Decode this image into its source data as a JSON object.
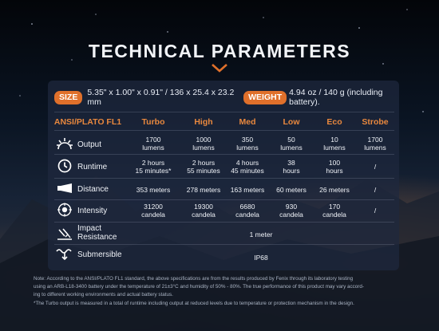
{
  "title": "TECHNICAL PARAMETERS",
  "specs": {
    "size_label": "SIZE",
    "size_value": "5.35\" x 1.00\" x 0.91\" / 136 x 25.4 x 23.2 mm",
    "weight_label": "WEIGHT",
    "weight_value": "4.94 oz / 140 g (including battery)."
  },
  "table": {
    "headers": [
      "ANSI/PLATO FL1",
      "Turbo",
      "High",
      "Med",
      "Low",
      "Eco",
      "Strobe"
    ],
    "rows": [
      {
        "icon": "output-icon",
        "label": "Output",
        "cells": [
          [
            "1700",
            "lumens"
          ],
          [
            "1000",
            "lumens"
          ],
          [
            "350",
            "lumens"
          ],
          [
            "50",
            "lumens"
          ],
          [
            "10",
            "lumens"
          ],
          [
            "1700",
            "lumens"
          ]
        ]
      },
      {
        "icon": "clock-icon",
        "label": "Runtime",
        "cells": [
          [
            "2 hours",
            "15 minutes*"
          ],
          [
            "2 hours",
            "55 minutes"
          ],
          [
            "4 hours",
            "45 minutes"
          ],
          [
            "38",
            "hours"
          ],
          [
            "100",
            "hours"
          ],
          [
            "/",
            ""
          ]
        ]
      },
      {
        "icon": "beam-distance-icon",
        "label": "Distance",
        "cells": [
          [
            "353 meters",
            ""
          ],
          [
            "278 meters",
            ""
          ],
          [
            "163 meters",
            ""
          ],
          [
            "60 meters",
            ""
          ],
          [
            "26 meters",
            ""
          ],
          [
            "/",
            ""
          ]
        ]
      },
      {
        "icon": "intensity-icon",
        "label": "Intensity",
        "cells": [
          [
            "31200",
            "candela"
          ],
          [
            "19300",
            "candela"
          ],
          [
            "6680",
            "candela"
          ],
          [
            "930",
            "candela"
          ],
          [
            "170",
            "candela"
          ],
          [
            "/",
            ""
          ]
        ]
      }
    ],
    "impact": {
      "icon": "impact-icon",
      "label_line1": "Impact",
      "label_line2": "Resistance",
      "value": "1 meter"
    },
    "submersible": {
      "icon": "submersible-icon",
      "label": "Submersible",
      "value": "IP68"
    }
  },
  "notes": {
    "line1": "Note: According to the ANSI/PLATO FL1 standard, the above specifications are from the results produced by Fenix through its laboratory testing",
    "line2": "using an ARB-L18-3400 battery under the temperature of 21±3°C and humidity of 50% - 80%. The true performance of this product may vary accord-",
    "line3": "ing to different working environments and actual battery status.",
    "line4": "*The Turbo output is measured in a total of runtime including output at reduced levels due to temperature or protection mechanism in the design."
  },
  "colors": {
    "accent": "#e0702b",
    "header_text": "#e8883e",
    "panel": "#1e283e"
  }
}
